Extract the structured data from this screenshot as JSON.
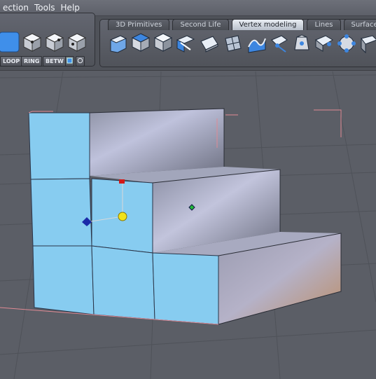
{
  "menu": {
    "items": [
      "ection",
      "Tools",
      "Help"
    ]
  },
  "toolbar": {
    "tabs": [
      "3D Primitives",
      "Second Life",
      "Vertex modeling",
      "Lines",
      "Surface"
    ],
    "active_tab": "Vertex modeling",
    "selection_buttons": [
      "LOOP",
      "RING",
      "BETW"
    ]
  },
  "icons": {
    "left_panel": [
      "select-mode-icon",
      "cube-vertex-icon",
      "cube-edge-icon",
      "cube-face-icon"
    ],
    "vertex_tools": [
      "bevel-icon",
      "extrude-icon",
      "cube-solid-icon",
      "knife-icon",
      "plane-icon",
      "subdivide-icon",
      "smooth-icon",
      "move-vertex-icon",
      "tweak-icon",
      "bridge-icon",
      "weld-icon",
      "split-icon"
    ]
  },
  "viewport": {
    "colors": {
      "selected_face": "#87ccf0",
      "background": "#5b5e66",
      "gizmo_center": "#f2e21a",
      "gizmo_x": "#1a2aa8",
      "gizmo_y": "#d21a1a",
      "gizmo_pivot": "#22b83a"
    }
  }
}
